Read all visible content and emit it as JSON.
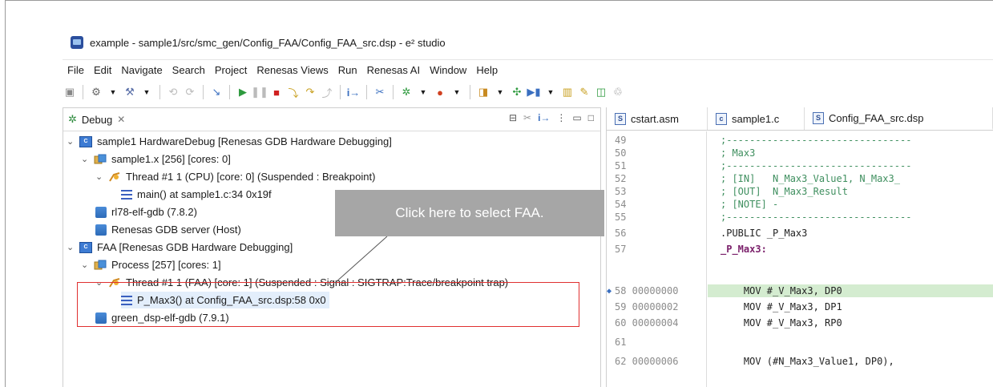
{
  "window": {
    "title": "example - sample1/src/smc_gen/Config_FAA/Config_FAA_src.dsp - e² studio"
  },
  "menu": [
    "File",
    "Edit",
    "Navigate",
    "Search",
    "Project",
    "Renesas Views",
    "Run",
    "Renesas AI",
    "Window",
    "Help"
  ],
  "debug_view": {
    "tab_label": "Debug",
    "tree": [
      "sample1 HardwareDebug [Renesas GDB Hardware Debugging]",
      "sample1.x [256] [cores: 0]",
      "Thread #1 1 (CPU) [core: 0] (Suspended : Breakpoint)",
      "main() at sample1.c:34 0x19f",
      "rl78-elf-gdb (7.8.2)",
      "Renesas GDB server (Host)",
      "FAA [Renesas GDB Hardware Debugging]",
      "Process [257] [cores: 1]",
      "Thread #1 1 (FAA) [core: 1] (Suspended : Signal : SIGTRAP:Trace/breakpoint trap)",
      "P_Max3() at Config_FAA_src.dsp:58 0x0",
      "green_dsp-elf-gdb (7.9.1)"
    ]
  },
  "editor": {
    "tabs": [
      {
        "label": "cstart.asm",
        "icon": "S"
      },
      {
        "label": "sample1.c",
        "icon": "c"
      },
      {
        "label": "Config_FAA_src.dsp",
        "icon": "S"
      }
    ],
    "lines": [
      {
        "num": "49",
        "text": ";--------------------------------",
        "comment": true
      },
      {
        "num": "50",
        "text": "; Max3",
        "comment": true
      },
      {
        "num": "51",
        "text": ";--------------------------------",
        "comment": true
      },
      {
        "num": "52",
        "text": "; [IN]   N_Max3_Value1, N_Max3_",
        "comment": true
      },
      {
        "num": "53",
        "text": "; [OUT]  N_Max3_Result",
        "comment": true
      },
      {
        "num": "54",
        "text": "; [NOTE] -",
        "comment": true
      },
      {
        "num": "55",
        "text": ";--------------------------------",
        "comment": true
      },
      {
        "num": "56",
        "text": ".PUBLIC _P_Max3",
        "comment": false
      },
      {
        "num": "57",
        "text": "_P_Max3:",
        "comment": false
      },
      {
        "num": "58 00000000",
        "text": "    MOV #_V_Max3, DP0",
        "comment": false
      },
      {
        "num": "59 00000002",
        "text": "    MOV #_V_Max3, DP1",
        "comment": false
      },
      {
        "num": "60 00000004",
        "text": "    MOV #_V_Max3, RP0",
        "comment": false
      },
      {
        "num": "61",
        "text": "",
        "comment": false
      },
      {
        "num": "62 00000006",
        "text": "    MOV (#N_Max3_Value1, DP0),",
        "comment": false
      }
    ]
  },
  "callout": {
    "text": "Click here to select FAA."
  }
}
